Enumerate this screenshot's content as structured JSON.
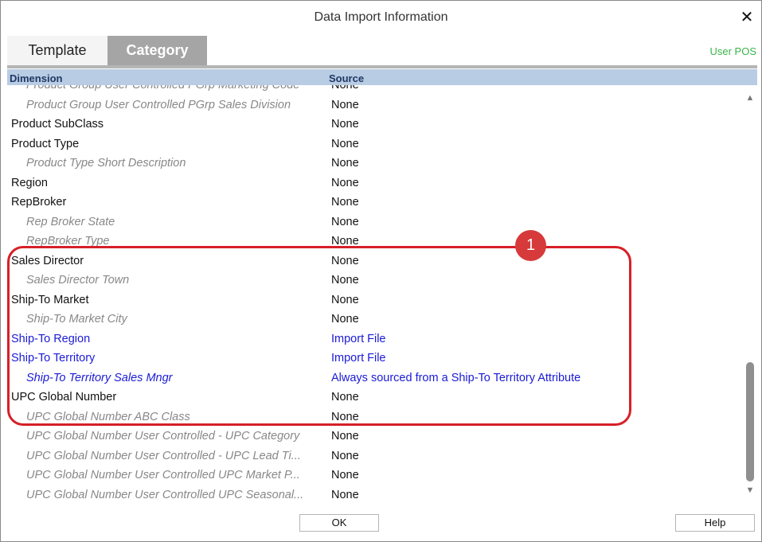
{
  "window": {
    "title": "Data Import Information",
    "close_glyph": "✕"
  },
  "tabs": [
    {
      "label": "Template",
      "active": false
    },
    {
      "label": "Category",
      "active": true
    }
  ],
  "user_label": "User POS",
  "columns": {
    "dimension": "Dimension",
    "source": "Source"
  },
  "rows": [
    {
      "dimension": "Product Group User Controlled PGrp Marketing Code",
      "source": "None",
      "level": "child",
      "import": false
    },
    {
      "dimension": "Product Group User Controlled PGrp Sales Division",
      "source": "None",
      "level": "child",
      "import": false
    },
    {
      "dimension": "Product SubClass",
      "source": "None",
      "level": "parent",
      "import": false
    },
    {
      "dimension": "Product Type",
      "source": "None",
      "level": "parent",
      "import": false
    },
    {
      "dimension": "Product Type Short Description",
      "source": "None",
      "level": "child",
      "import": false
    },
    {
      "dimension": "Region",
      "source": "None",
      "level": "parent",
      "import": false
    },
    {
      "dimension": "RepBroker",
      "source": "None",
      "level": "parent",
      "import": false
    },
    {
      "dimension": "Rep Broker State",
      "source": "None",
      "level": "child",
      "import": false
    },
    {
      "dimension": "RepBroker Type",
      "source": "None",
      "level": "child",
      "import": false
    },
    {
      "dimension": "Sales Director",
      "source": "None",
      "level": "parent",
      "import": false
    },
    {
      "dimension": "Sales Director Town",
      "source": "None",
      "level": "child",
      "import": false
    },
    {
      "dimension": "Ship-To Market",
      "source": "None",
      "level": "parent",
      "import": false
    },
    {
      "dimension": "Ship-To Market City",
      "source": "None",
      "level": "child",
      "import": false
    },
    {
      "dimension": "Ship-To Region",
      "source": "Import File",
      "level": "parent",
      "import": true
    },
    {
      "dimension": "Ship-To Territory",
      "source": "Import File",
      "level": "parent",
      "import": true
    },
    {
      "dimension": "Ship-To Territory Sales Mngr",
      "source": "Always sourced from a Ship-To Territory Attribute",
      "level": "child",
      "import": true
    },
    {
      "dimension": "UPC Global Number",
      "source": "None",
      "level": "parent",
      "import": false
    },
    {
      "dimension": "UPC Global Number ABC Class",
      "source": "None",
      "level": "child",
      "import": false
    },
    {
      "dimension": "UPC Global Number User Controlled - UPC Category",
      "source": "None",
      "level": "child",
      "import": false
    },
    {
      "dimension": "UPC Global Number User Controlled - UPC Lead Ti...",
      "source": "None",
      "level": "child",
      "import": false
    },
    {
      "dimension": "UPC Global Number User Controlled UPC Market P...",
      "source": "None",
      "level": "child",
      "import": false
    },
    {
      "dimension": "UPC Global Number User Controlled UPC Seasonal...",
      "source": "None",
      "level": "child",
      "import": false
    }
  ],
  "callout_number": "1",
  "buttons": {
    "ok": "OK",
    "help": "Help"
  },
  "colors": {
    "import_text": "#1a1ad6",
    "highlight": "#d62027",
    "header_bg": "#b8cce4",
    "user_pos": "#3ab54a"
  }
}
